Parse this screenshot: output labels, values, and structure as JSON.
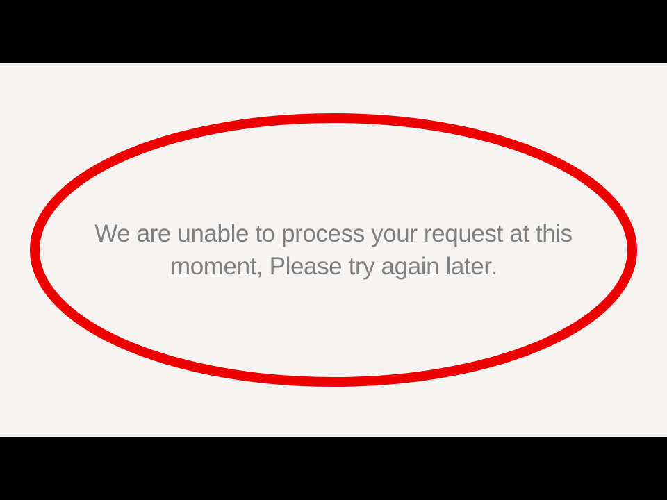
{
  "message": {
    "line1": "We are unable to process your request at this",
    "line2": "moment, Please try again later."
  },
  "colors": {
    "highlight": "#ee0000",
    "background_panel": "#f5f4f2",
    "bars": "#000000",
    "text": "#808080"
  }
}
